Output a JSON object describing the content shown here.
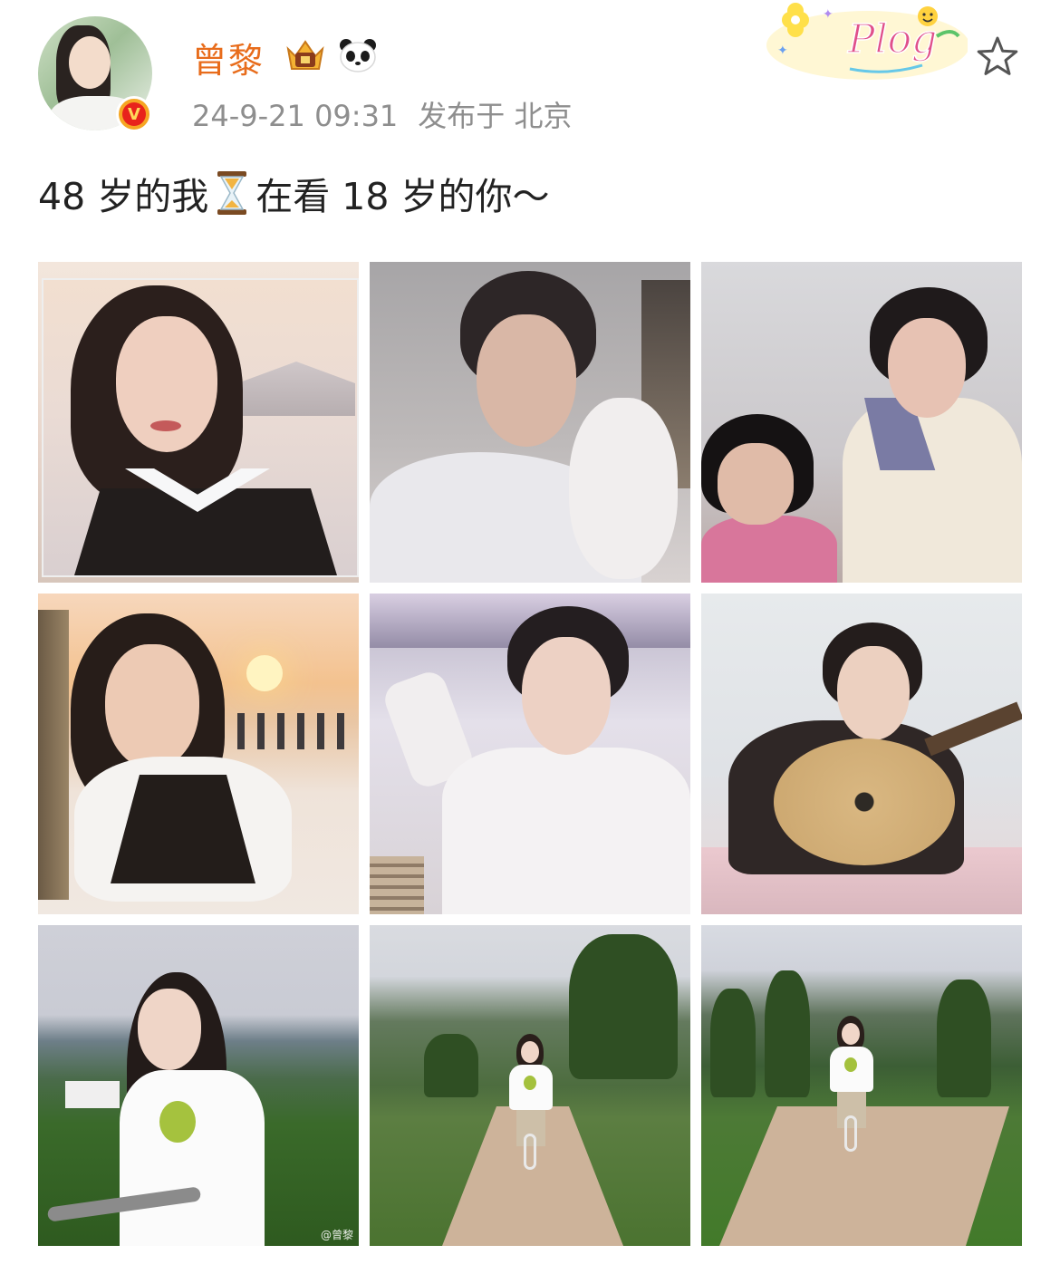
{
  "post": {
    "username": "曾黎",
    "timestamp": "24-9-21 09:31",
    "source": "发布于 北京",
    "badge_text": "V",
    "plog_text": "Plog",
    "text_before": "48 岁的我",
    "text_after": "在看 18 岁的你～"
  },
  "photos": [
    {
      "caption": ""
    },
    {
      "caption": ""
    },
    {
      "caption": ""
    },
    {
      "caption": ""
    },
    {
      "caption": ""
    },
    {
      "caption": ""
    },
    {
      "caption": "@曾黎"
    },
    {
      "caption": ""
    },
    {
      "caption": ""
    }
  ],
  "icons": {
    "crown_badge": "crown-badge-icon",
    "panda_badge": "panda-icon",
    "star_button": "star-icon",
    "hourglass": "hourglass-icon"
  },
  "colors": {
    "username": "#e86c1b",
    "meta": "#8e8e8e",
    "verified_outer": "#f6a623",
    "verified_inner": "#e8231c"
  }
}
